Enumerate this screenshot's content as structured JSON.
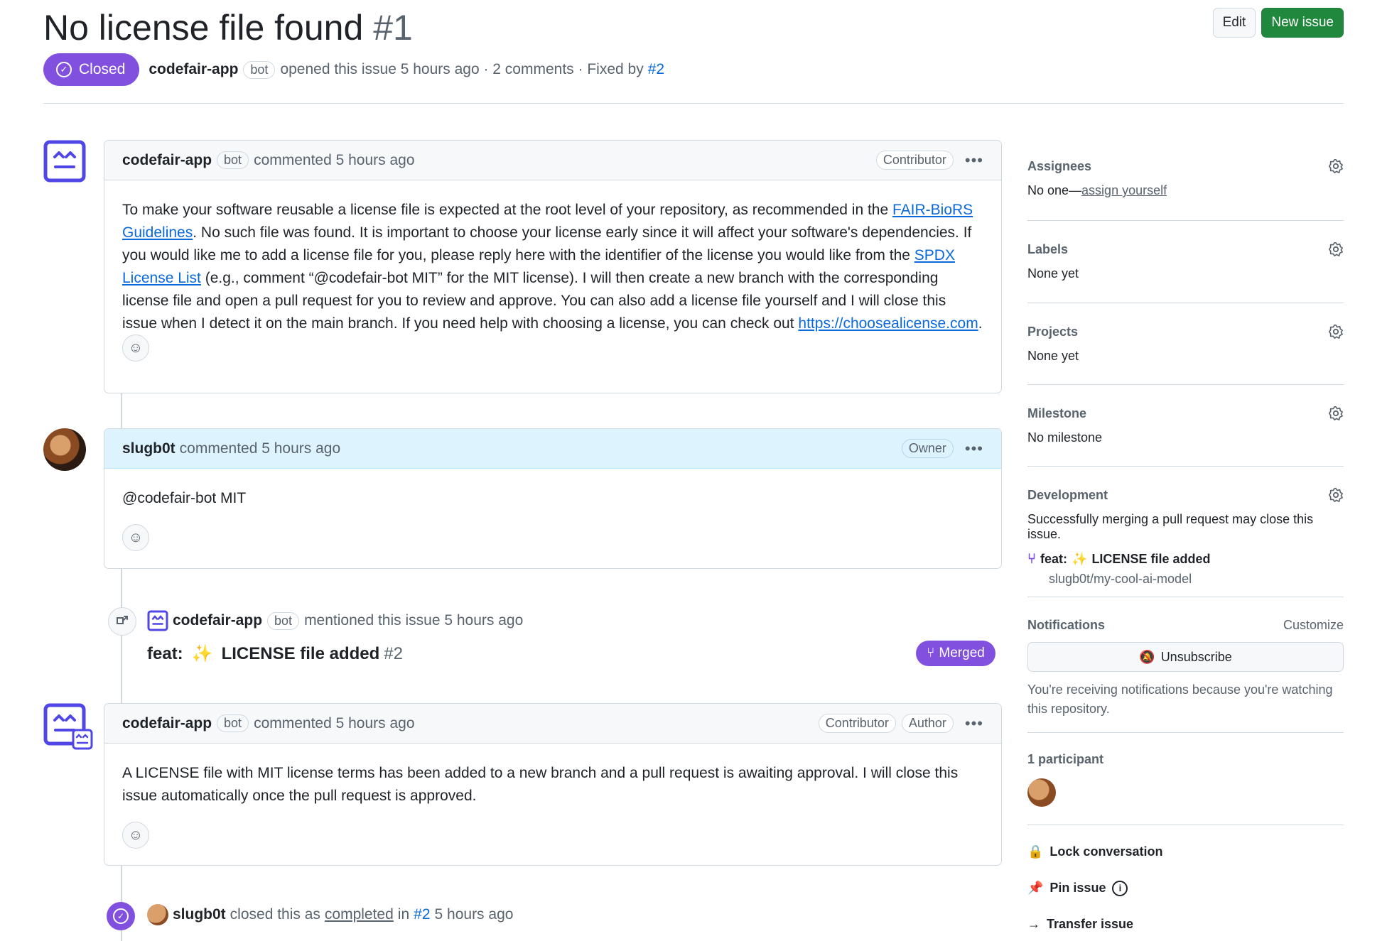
{
  "issue": {
    "title": "No license file found",
    "number": "#1",
    "state": "Closed",
    "author": "codefair-app",
    "author_tag": "bot",
    "meta_text": "opened this issue 5 hours ago · 2 comments · Fixed by",
    "fixed_by": "#2"
  },
  "header_buttons": {
    "edit": "Edit",
    "new_issue": "New issue"
  },
  "comments": [
    {
      "author": "codefair-app",
      "tag": "bot",
      "time": "commented 5 hours ago",
      "roles": [
        "Contributor"
      ],
      "body": {
        "p1": "To make your software reusable a license file is expected at the root level of your repository, as recommended in the ",
        "link1": "FAIR-BioRS Guidelines",
        "p2": ". No such file was found. It is important to choose your license early since it will affect your software's dependencies. If you would like me to add a license file for you, please reply here with the identifier of the license you would like from the ",
        "link2": "SPDX License List",
        "p3": " (e.g., comment “@codefair-bot MIT” for the MIT license). I will then create a new branch with the corresponding license file and open a pull request for you to review and approve. You can also add a license file yourself and I will close this issue when I detect it on the main branch. If you need help with choosing a license, you can check out ",
        "link3": "https://choosealicense.com",
        "p4": "."
      }
    },
    {
      "author": "slugb0t",
      "time": "commented 5 hours ago",
      "roles": [
        "Owner"
      ],
      "body": "@codefair-bot MIT"
    },
    {
      "author": "codefair-app",
      "tag": "bot",
      "time": "commented 5 hours ago",
      "roles": [
        "Contributor",
        "Author"
      ],
      "body": "A LICENSE file with MIT license terms has been added to a new branch and a pull request is awaiting approval. I will close this issue automatically once the pull request is approved."
    }
  ],
  "mention_event": {
    "author": "codefair-app",
    "tag": "bot",
    "text": "mentioned this issue 5 hours ago",
    "pr_title_prefix": "feat:",
    "pr_title_suffix": "LICENSE file added",
    "pr_number": "#2",
    "status": "Merged"
  },
  "close_event": {
    "author": "slugb0t",
    "text1": "closed this as",
    "completed": "completed",
    "in": "in",
    "pr": "#2",
    "time": "5 hours ago"
  },
  "sidebar": {
    "assignees": {
      "label": "Assignees",
      "none": "No one—",
      "link": "assign yourself"
    },
    "labels": {
      "label": "Labels",
      "value": "None yet"
    },
    "projects": {
      "label": "Projects",
      "value": "None yet"
    },
    "milestone": {
      "label": "Milestone",
      "value": "No milestone"
    },
    "development": {
      "label": "Development",
      "note": "Successfully merging a pull request may close this issue.",
      "pr_prefix": "feat:",
      "pr_suffix": "LICENSE file added",
      "repo": "slugb0t/my-cool-ai-model"
    },
    "notifications": {
      "label": "Notifications",
      "customize": "Customize",
      "button": "Unsubscribe",
      "note": "You're receiving notifications because you're watching this repository."
    },
    "participants": {
      "label": "1 participant"
    },
    "actions": {
      "lock": "Lock conversation",
      "pin": "Pin issue",
      "transfer": "Transfer issue"
    }
  },
  "colors": {
    "closed": "#8250df",
    "merged": "#8250df",
    "primary": "#1f883d",
    "link": "#0969da",
    "bot_icon": "#4f46e5"
  }
}
